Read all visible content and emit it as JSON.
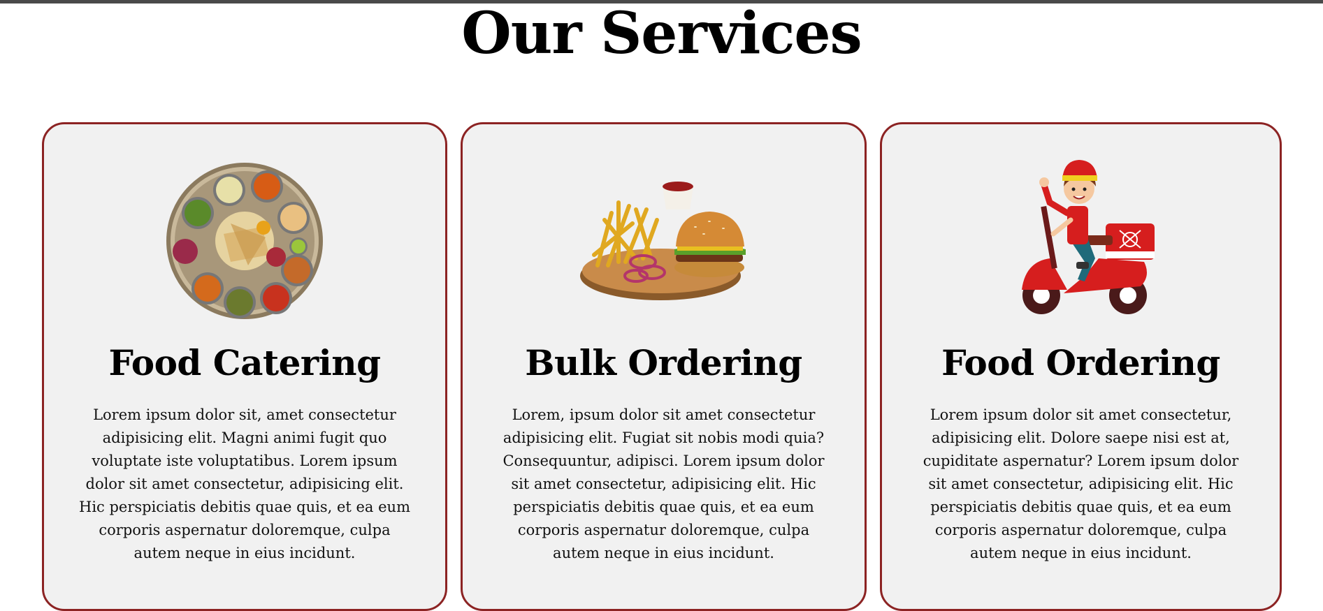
{
  "section": {
    "title": "Our Services"
  },
  "cards": [
    {
      "image": "indian-thali-plate-image",
      "title": "Food Catering",
      "description": "Lorem ipsum dolor sit, amet consectetur adipisicing elit. Magni animi fugit quo voluptate iste voluptatibus. Lorem ipsum dolor sit amet consectetur, adipisicing elit. Hic perspiciatis debitis quae quis, et ea eum corporis aspernatur doloremque, culpa autem neque in eius incidunt."
    },
    {
      "image": "burger-fries-board-image",
      "title": "Bulk Ordering",
      "description": "Lorem, ipsum dolor sit amet consectetur adipisicing elit. Fugiat sit nobis modi quia? Consequuntur, adipisci. Lorem ipsum dolor sit amet consectetur, adipisicing elit. Hic perspiciatis debitis quae quis, et ea eum corporis aspernatur doloremque, culpa autem neque in eius incidunt."
    },
    {
      "image": "delivery-scooter-rider-image",
      "title": "Food Ordering",
      "description": "Lorem ipsum dolor sit amet consectetur, adipisicing elit. Dolore saepe nisi est at, cupiditate aspernatur? Lorem ipsum dolor sit amet consectetur, adipisicing elit. Hic perspiciatis debitis quae quis, et ea eum corporis aspernatur doloremque, culpa autem neque in eius incidunt."
    }
  ],
  "colors": {
    "card_border": "#8c2323",
    "card_background": "#f1f1f1",
    "top_bar": "#4a4a4a"
  }
}
